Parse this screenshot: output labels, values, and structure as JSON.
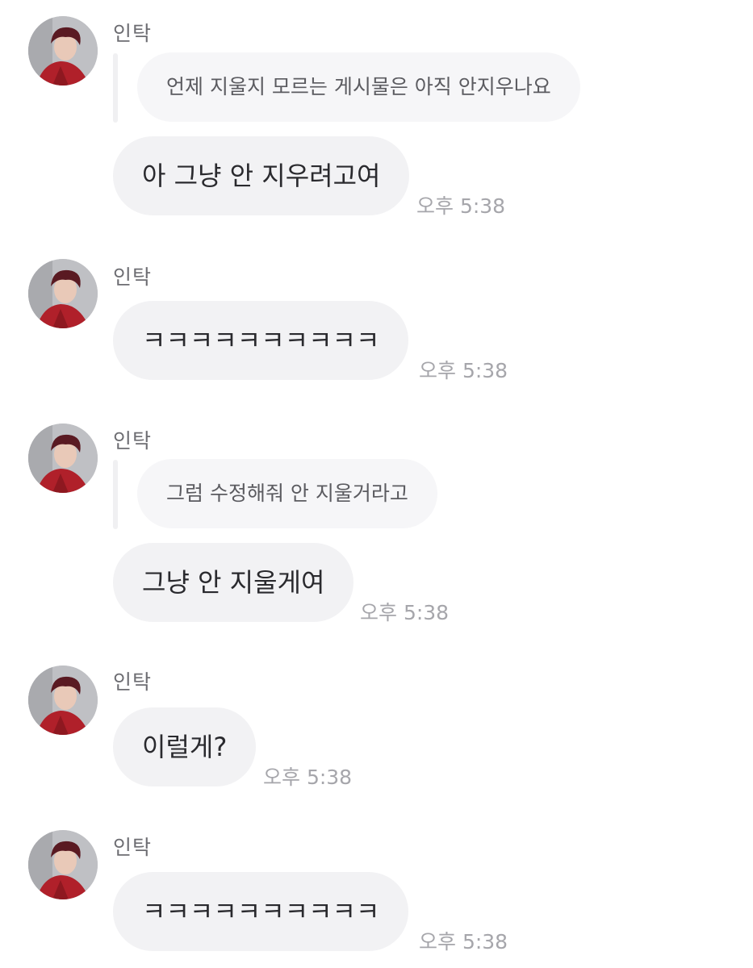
{
  "messages": [
    {
      "sender": "인탁",
      "quote": "언제 지울지 모르는 게시물은 아직 안지우나요",
      "text": "아 그냥 안 지우려고여",
      "time": "오후 5:38"
    },
    {
      "sender": "인탁",
      "text": "ㅋㅋㅋㅋㅋㅋㅋㅋㅋㅋ",
      "time": "오후 5:38"
    },
    {
      "sender": "인탁",
      "quote": "그럼 수정해줘 안 지울거라고",
      "text": "그냥 안 지울게여",
      "time": "오후 5:38"
    },
    {
      "sender": "인탁",
      "text": "이럴게?",
      "time": "오후 5:38"
    },
    {
      "sender": "인탁",
      "text": "ㅋㅋㅋㅋㅋㅋㅋㅋㅋㅋ",
      "time": "오후 5:38"
    }
  ]
}
